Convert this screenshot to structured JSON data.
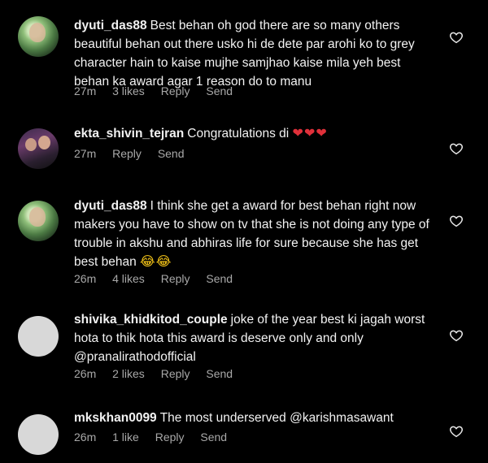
{
  "comments": [
    {
      "username": "dyuti_das88",
      "text": "Best behan oh god there are so many others beautiful behan out there usko hi de dete par arohi ko to grey character hain to kaise mujhe samjhao kaise mila yeh best behan ka award agar 1 reason do to manu",
      "time": "27m",
      "likes": "3 likes",
      "reply": "Reply",
      "send": "Send"
    },
    {
      "username": "ekta_shivin_tejran",
      "text": "Congratulations di",
      "emoji": "❤❤❤",
      "time": "27m",
      "reply": "Reply",
      "send": "Send"
    },
    {
      "username": "dyuti_das88",
      "text": "I think she get a award for best behan right now makers you have to show on tv that she is not doing any type of trouble in akshu and abhiras life for sure because she has get best behan",
      "emoji": "😂😂",
      "time": "26m",
      "likes": "4 likes",
      "reply": "Reply",
      "send": "Send"
    },
    {
      "username": "shivika_khidkitod_couple",
      "text": "joke of the year best ki jagah worst hota to thik hota this award is deserve only and only",
      "mention": "@pranalirathodofficial",
      "time": "26m",
      "likes": "2 likes",
      "reply": "Reply",
      "send": "Send"
    },
    {
      "username": "mkskhan0099",
      "text": "The most underserved",
      "mention": "@karishmasawant",
      "time": "26m",
      "likes": "1 like",
      "reply": "Reply",
      "send": "Send"
    }
  ],
  "icons": {
    "like": "heart-outline-icon"
  },
  "colors": {
    "background": "#000000",
    "text": "#f2f2f2",
    "meta": "#a8a8a8",
    "heart_emoji": "#e0303a"
  }
}
